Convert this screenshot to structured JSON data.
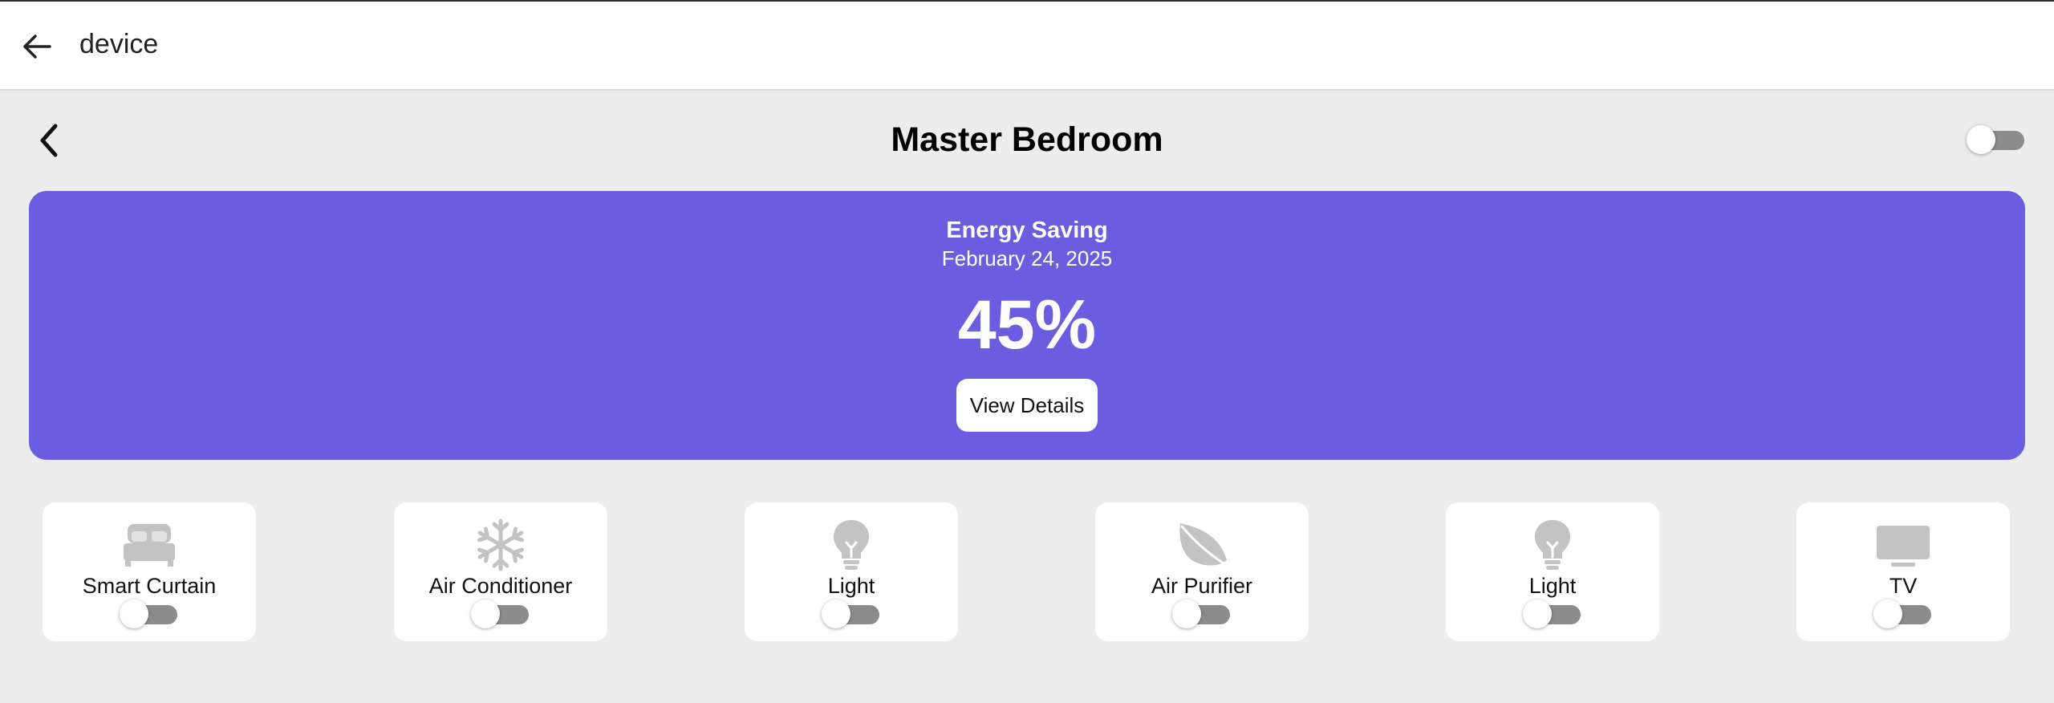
{
  "app_bar": {
    "title": "device"
  },
  "room": {
    "title": "Master Bedroom",
    "master_toggle_on": false
  },
  "banner": {
    "title": "Energy Saving",
    "date": "February 24, 2025",
    "value": "45%",
    "button_label": "View Details",
    "color": "#6b5de0"
  },
  "devices": [
    {
      "label": "Smart Curtain",
      "icon": "bed-icon",
      "on": false
    },
    {
      "label": "Air Conditioner",
      "icon": "snowflake-icon",
      "on": false
    },
    {
      "label": "Light",
      "icon": "lightbulb-icon",
      "on": false
    },
    {
      "label": "Air Purifier",
      "icon": "leaf-icon",
      "on": false
    },
    {
      "label": "Light",
      "icon": "lightbulb-icon",
      "on": false
    },
    {
      "label": "TV",
      "icon": "tv-icon",
      "on": false
    }
  ],
  "colors": {
    "background": "#ededed",
    "icon_gray": "#c3c3c3",
    "toggle_off": "#8c8c8c"
  }
}
